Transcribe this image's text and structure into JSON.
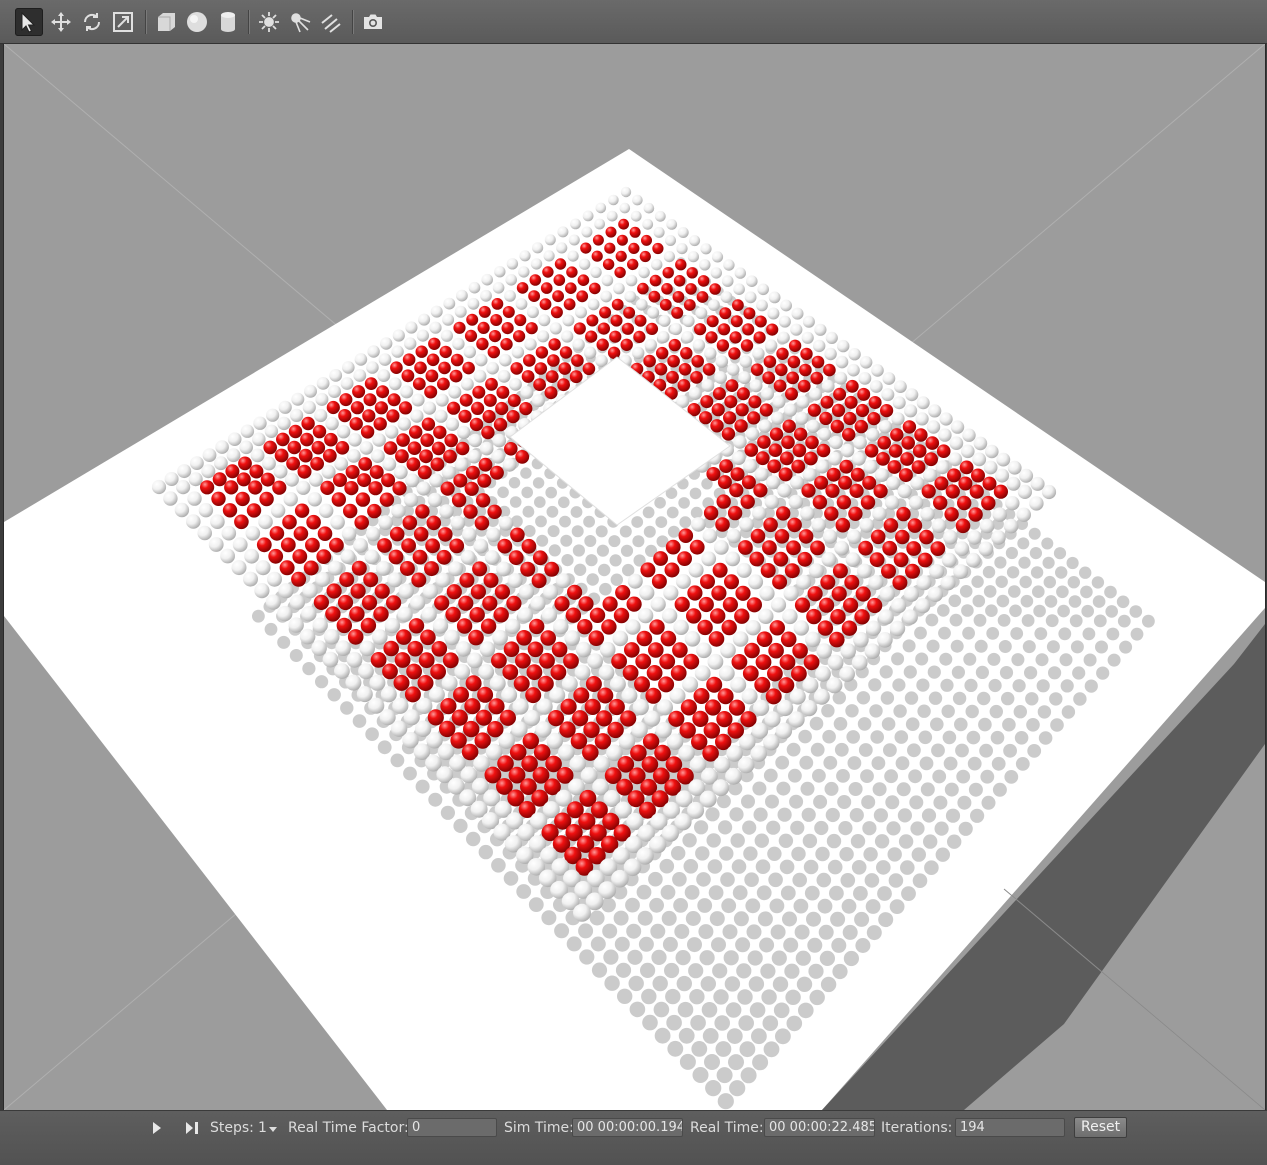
{
  "toolbar": {
    "tools": [
      {
        "name": "select-icon",
        "active": true
      },
      {
        "name": "translate-icon"
      },
      {
        "name": "rotate-icon"
      },
      {
        "name": "scale-icon"
      },
      {
        "name": "box-icon"
      },
      {
        "name": "sphere-icon"
      },
      {
        "name": "cylinder-icon"
      },
      {
        "name": "point-light-icon"
      },
      {
        "name": "spot-light-icon"
      },
      {
        "name": "directional-light-icon"
      },
      {
        "name": "camera-icon"
      }
    ]
  },
  "scene": {
    "colors": {
      "sky": "#9c9c9c",
      "ground": "#ffffff",
      "shadow": "#5a5a5a",
      "red_sphere": "#e60000",
      "white_sphere": "#f2f2f2"
    }
  },
  "bottom_bar": {
    "steps_label": "Steps:",
    "steps_value": "1",
    "rtf_label": "Real Time Factor:",
    "rtf_value": "0",
    "sim_time_label": "Sim Time:",
    "sim_time_value": "00 00:00:00.194",
    "real_time_label": "Real Time:",
    "real_time_value": "00 00:00:22.485",
    "iterations_label": "Iterations:",
    "iterations_value": "194",
    "reset_label": "Reset"
  }
}
